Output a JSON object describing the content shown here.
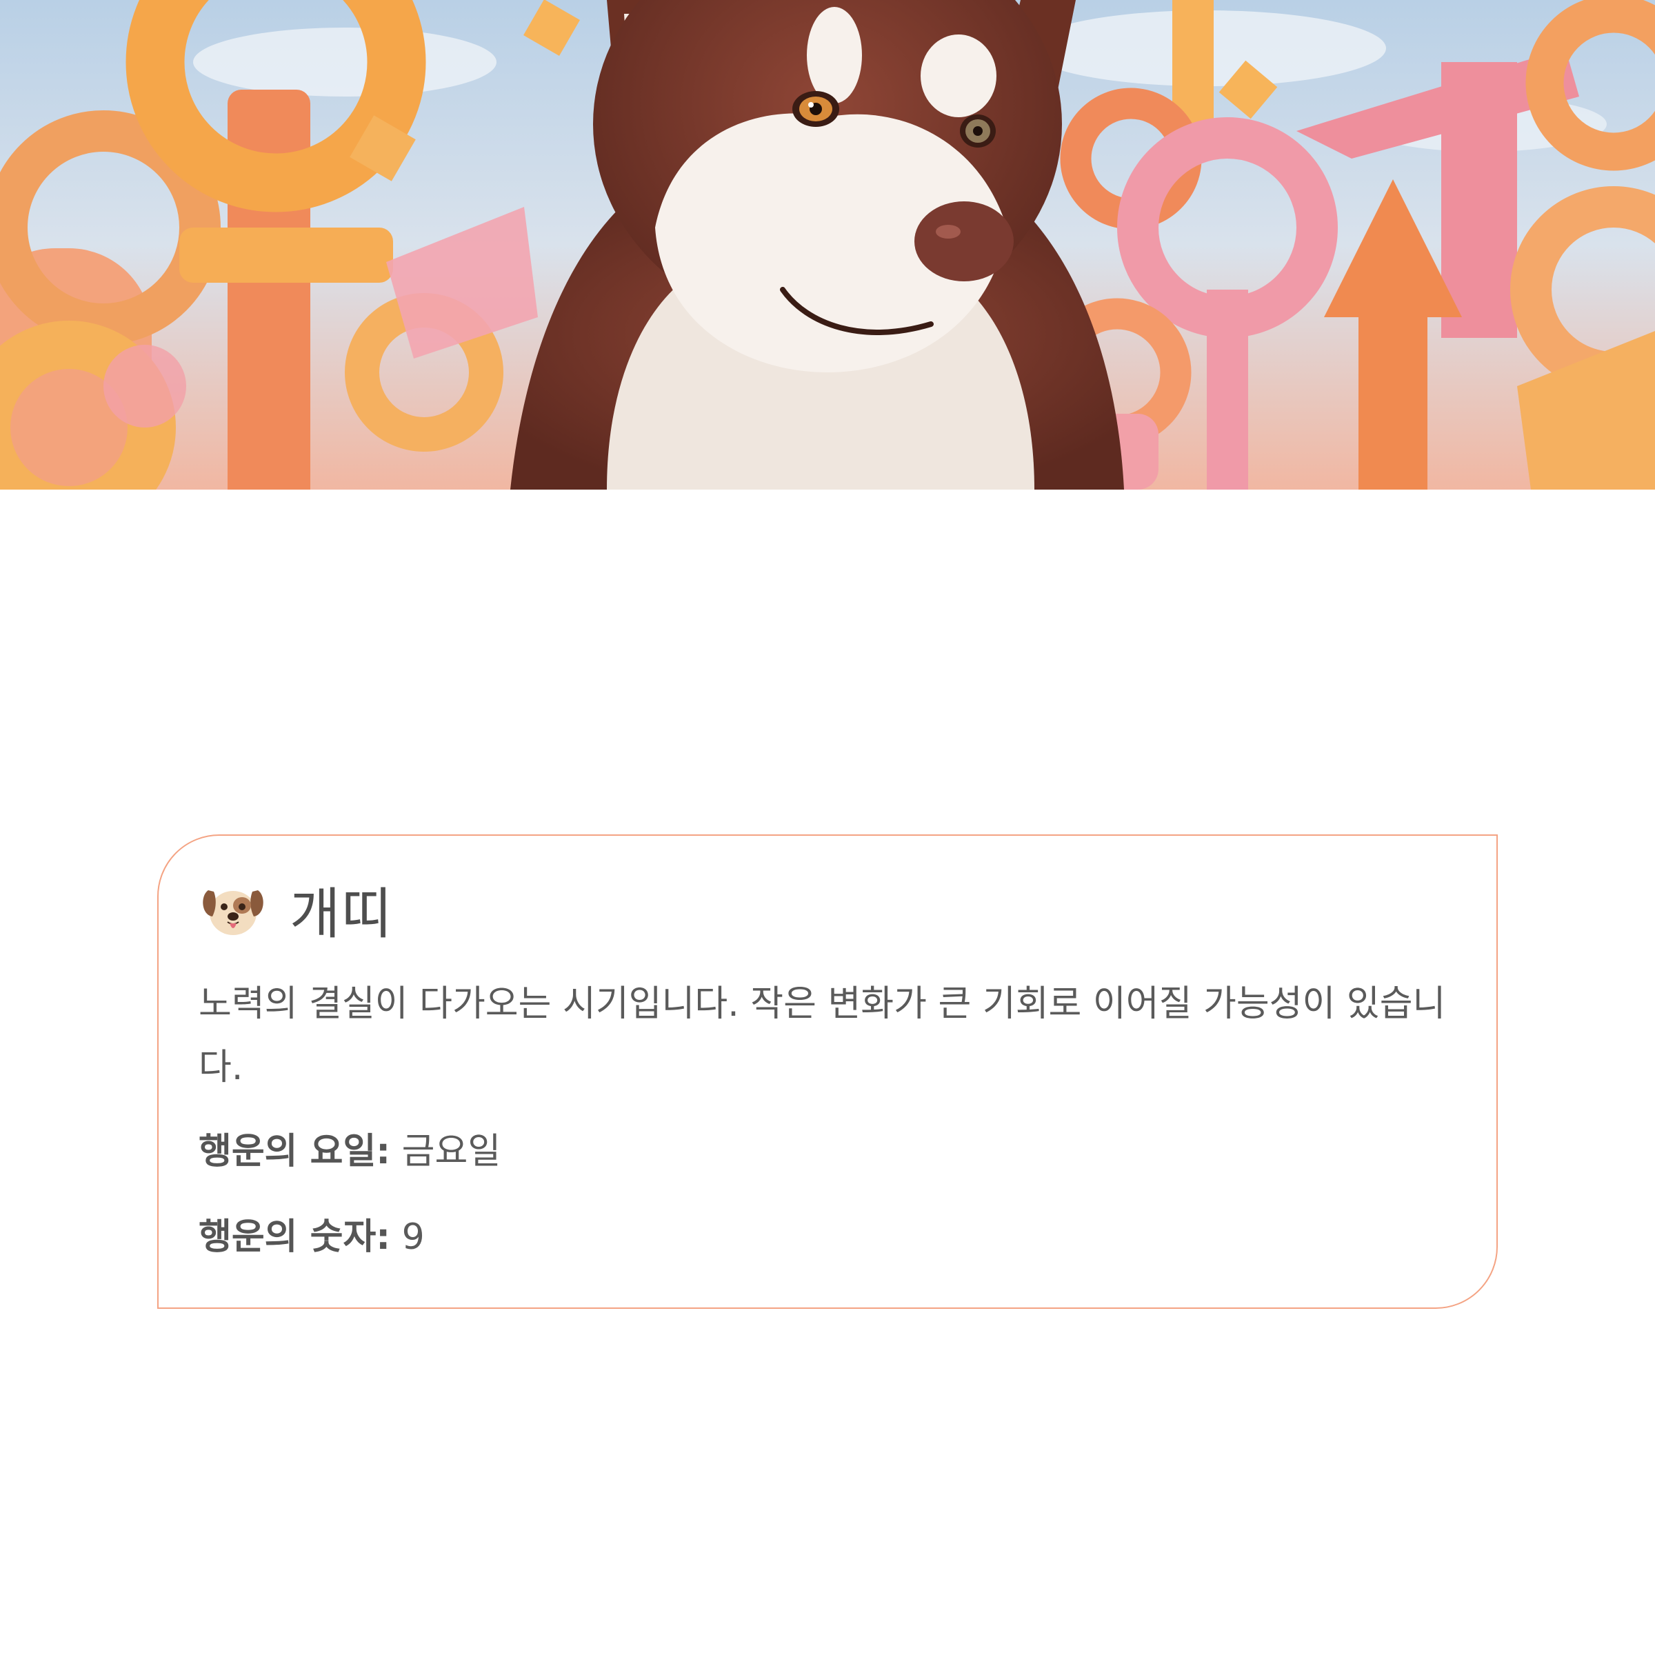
{
  "hero": {
    "image": "dog-zodiac-illustration",
    "colors": {
      "sky": "#bcd3e8",
      "orange": "#f5a44f",
      "pink": "#f2a0a8",
      "coral": "#f0825a",
      "dog_fur": "#7e3a2a",
      "dog_white": "#f7f1ec"
    }
  },
  "card": {
    "border_color": "#f4a383",
    "icon": "dog-face-icon",
    "title": "개띠",
    "description": "노력의 결실이 다가오는 시기입니다. 작은 변화가 큰 기회로 이어질 가능성이 있습니다.",
    "lucky_day": {
      "label": "행운의 요일:",
      "value": "금요일"
    },
    "lucky_number": {
      "label": "행운의 숫자:",
      "value": "9"
    }
  }
}
